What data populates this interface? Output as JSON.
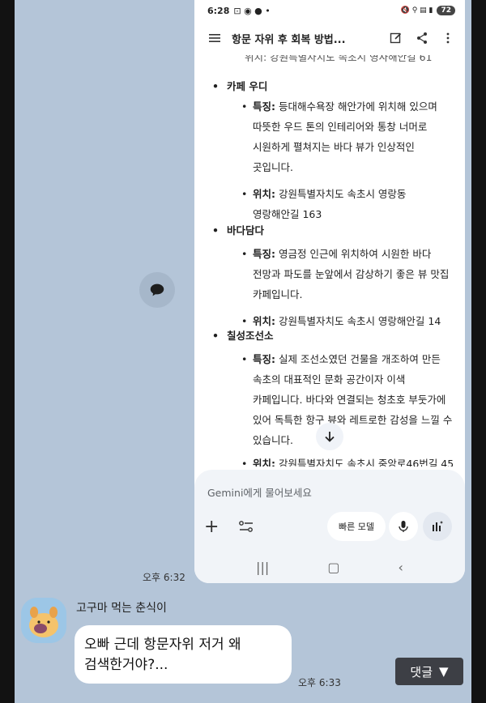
{
  "status_bar": {
    "time": "6:28",
    "battery": "72"
  },
  "app_bar": {
    "title": "항문 자위 후 회복 방법..."
  },
  "content": {
    "cut_line": "위치: 강원특별자치도 속초시 영사해안길 61",
    "cafes": [
      {
        "name": "카페 우디",
        "feature_label": "특징:",
        "feature_lines": [
          "등대해수욕장 해안가에 위치해 있으며",
          "따뜻한 우드 톤의 인테리어와 통창 너머로",
          "시원하게 펼쳐지는 바다 뷰가 인상적인",
          "곳입니다."
        ],
        "location_label": "위치:",
        "location_lines": [
          "강원특별자치도 속초시 영랑동",
          "영랑해안길 163"
        ]
      },
      {
        "name": "바다담다",
        "feature_label": "특징:",
        "feature_lines": [
          "영금정 인근에 위치하여 시원한 바다",
          "전망과 파도를 눈앞에서 감상하기 좋은 뷰 맛집",
          "카페입니다."
        ],
        "location_label": "위치:",
        "location_lines": [
          "강원특별자치도 속초시 영랑해안길 14"
        ]
      },
      {
        "name": "칠성조선소",
        "feature_label": "특징:",
        "feature_lines": [
          "실제 조선소였던 건물을 개조하여 만든",
          "속초의 대표적인 문화 공간이자 이색",
          "카페입니다. 바다와 연결되는 청초호 부둣가에",
          "있어 독특한 항구 뷰와 레트로한 감성을 느낄 수",
          "있습니다."
        ],
        "location_label": "위치:",
        "location_lines": [
          "강원특별자치도 속초시 중앙로46번길 45"
        ]
      }
    ]
  },
  "input": {
    "placeholder": "Gemini에게 물어보세요",
    "fast_model_label": "빠른 모델"
  },
  "chat": {
    "time_1": "오후 6:32",
    "sender_name": "고구마 먹는 춘식이",
    "message_line1": "오빠 근데 항문자위 저거 왜",
    "message_line2": "검색한거야?...",
    "time_2": "오후 6:33",
    "reply_label": "댓글"
  }
}
